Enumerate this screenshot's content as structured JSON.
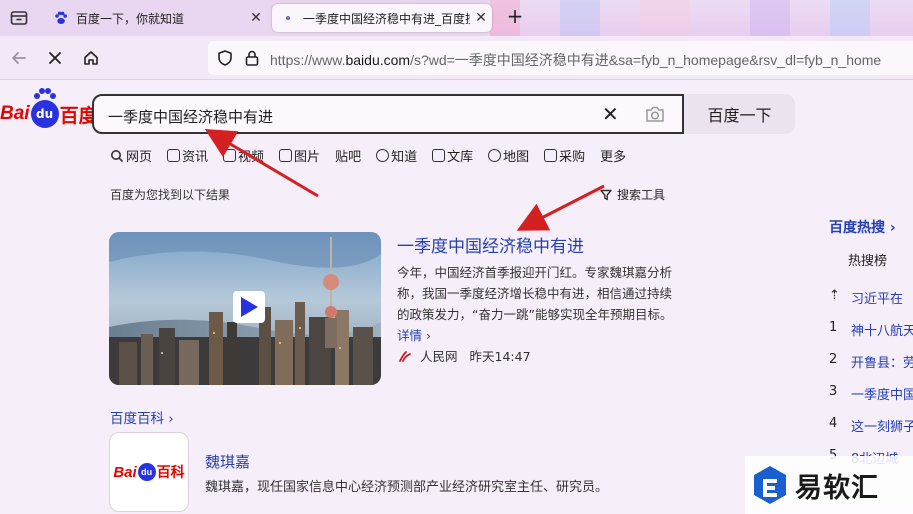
{
  "browser": {
    "tabs": [
      {
        "title": "百度一下，你就知道",
        "active": false
      },
      {
        "title": "一季度中国经济稳中有进_百度搜",
        "active": true
      }
    ],
    "url_prefix": "https://www.",
    "url_domain": "baidu.com",
    "url_rest": "/s?wd=一季度中国经济稳中有进&sa=fyb_n_homepage&rsv_dl=fyb_n_home"
  },
  "search": {
    "logo_bai": "Bai",
    "logo_du": "du",
    "logo_cn": "百度",
    "query": "一季度中国经济稳中有进",
    "button_label": "百度一下"
  },
  "nav_tabs": [
    "网页",
    "资讯",
    "视频",
    "图片",
    "贴吧",
    "知道",
    "文库",
    "地图",
    "采购",
    "更多"
  ],
  "result_info": "百度为您找到以下结果",
  "search_tools": "搜索工具",
  "result": {
    "title": "一季度中国经济稳中有进",
    "abstract": "今年，中国经济首季报迎开门红。专家魏琪嘉分析称，我国一季度经济增长稳中有进，相信通过持续的政策发力，“奋力一跳”能够实现全年预期目标。",
    "more_label": "详情 ›",
    "source": "人民网",
    "time": "昨天14:47"
  },
  "baike": {
    "header": "百度百科 ›",
    "logo_text_a": "Bai",
    "logo_text_b": "百科",
    "name": "魏琪嘉",
    "desc": "魏琪嘉，现任国家信息中心经济预测部产业经济研究室主任、研究员。"
  },
  "hot": {
    "title": "百度热搜 ›",
    "subtitle": "热搜榜",
    "items": [
      {
        "n": "⇡",
        "text": "习近平在"
      },
      {
        "n": "1",
        "text": "神十八航天"
      },
      {
        "n": "2",
        "text": "开鲁县：劳"
      },
      {
        "n": "3",
        "text": "一季度中国"
      },
      {
        "n": "4",
        "text": "这一刻狮子"
      },
      {
        "n": "5",
        "text": "8北辺城"
      }
    ]
  },
  "watermark": "易软汇",
  "colors": {
    "baidu_red": "#e10601",
    "baidu_blue": "#2932e1",
    "link_blue": "#2440b3",
    "arrow_red": "#d42020"
  }
}
